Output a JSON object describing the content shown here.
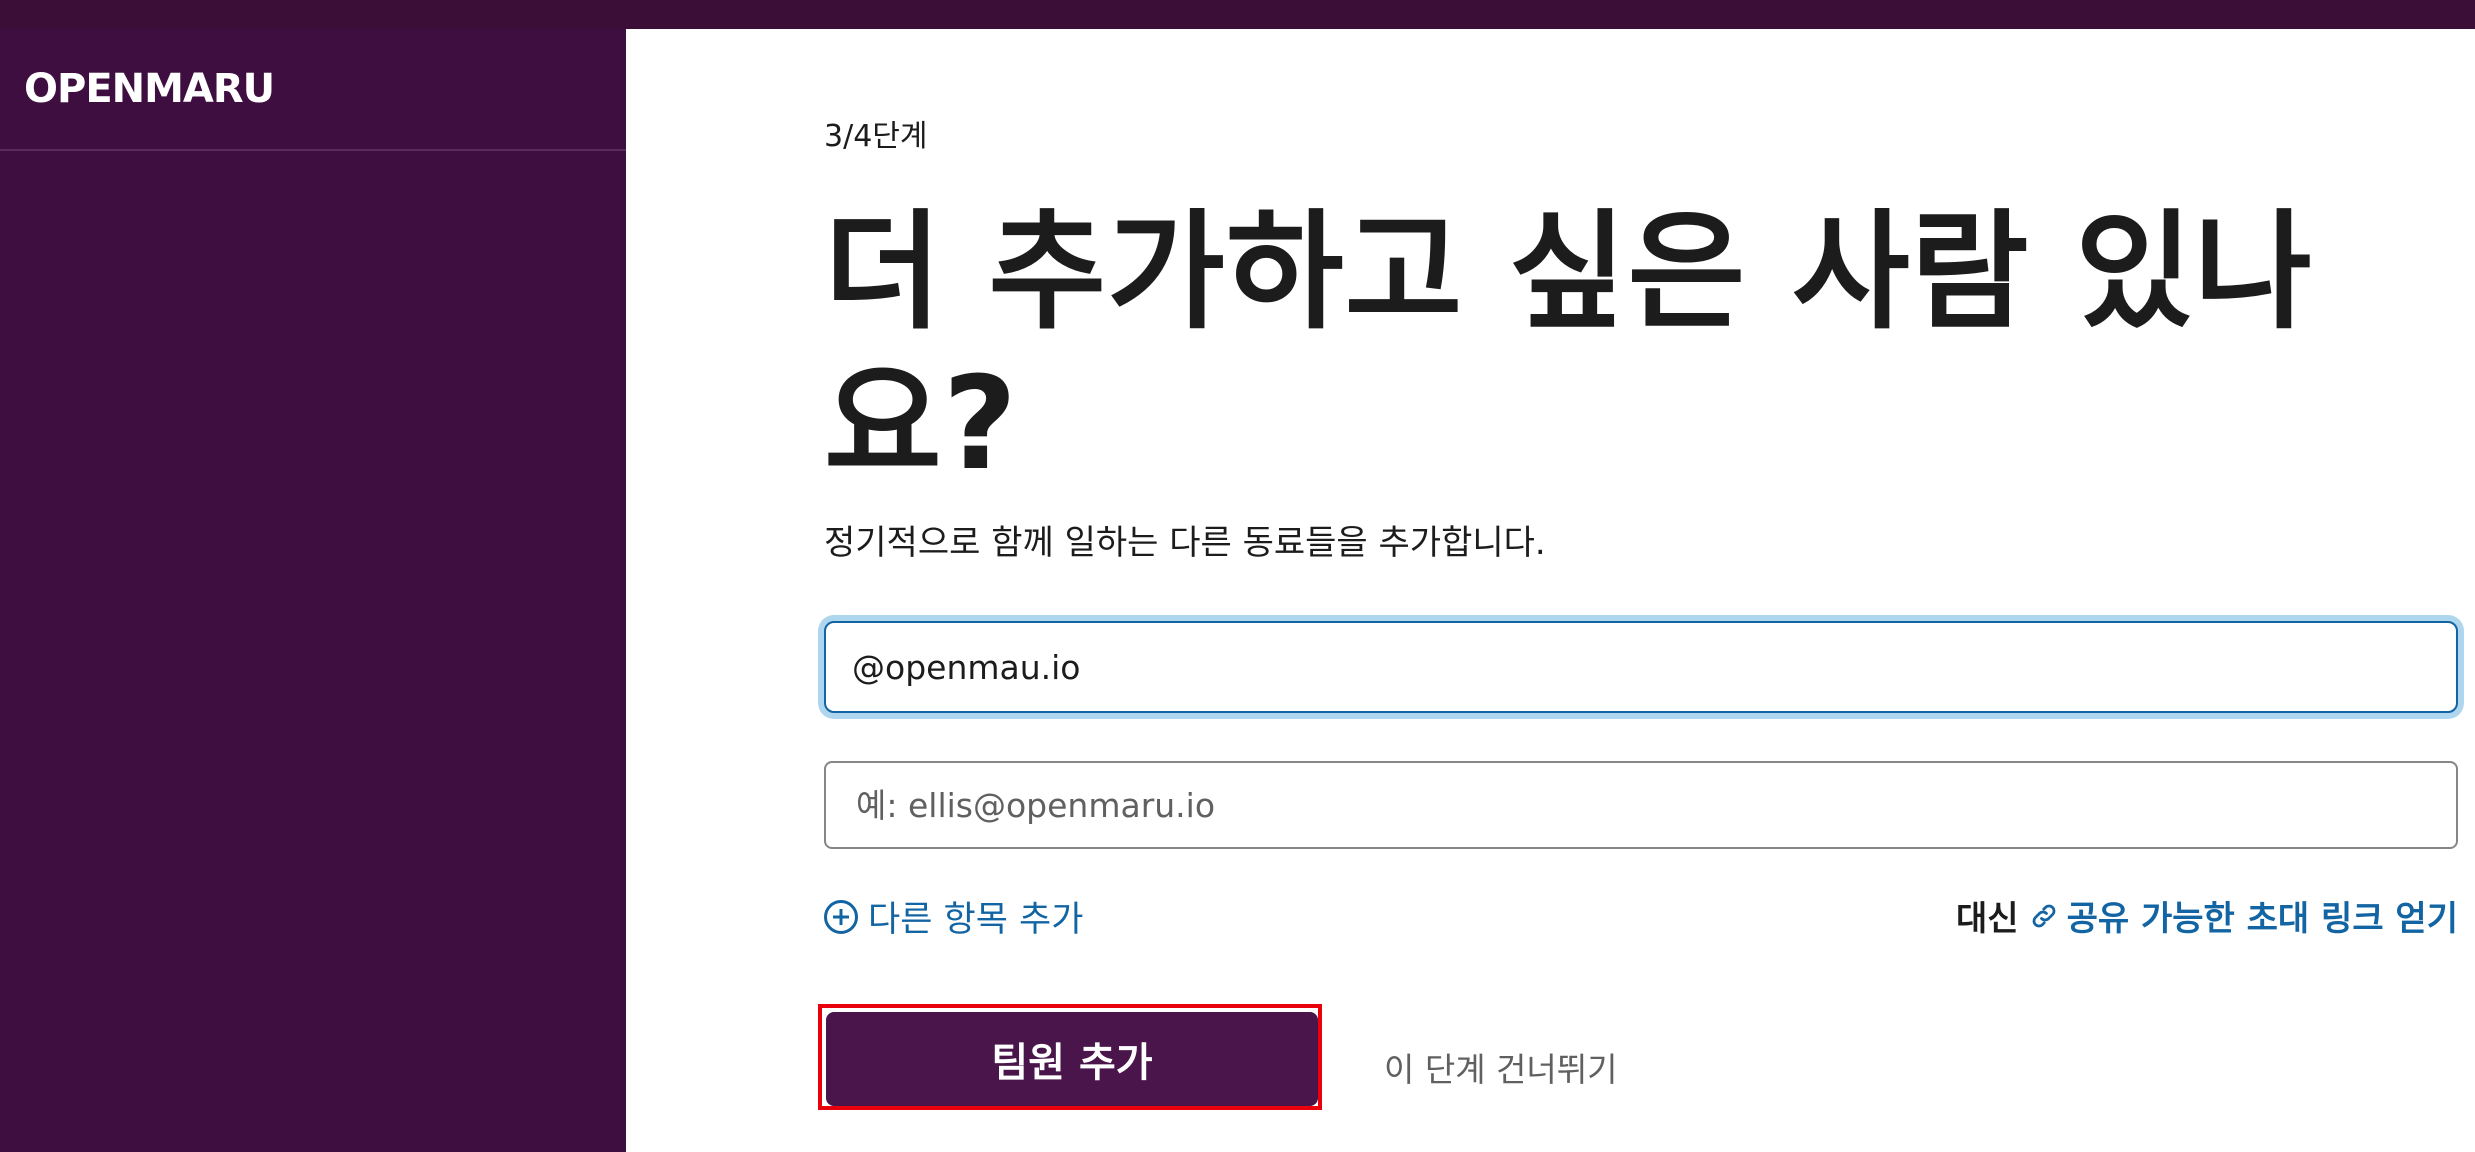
{
  "workspace": {
    "name": "OPENMARU"
  },
  "invite": {
    "step": "3/4단계",
    "title": "더 추가하고 싶은 사람 있나요?",
    "subtitle": "정기적으로 함께 일하는 다른 동료들을 추가합니다.",
    "email_inputs": [
      {
        "value": "@openmau.io",
        "placeholder": ""
      },
      {
        "value": "",
        "placeholder": "예: ellis@openmaru.io"
      }
    ],
    "add_item_label": "다른 항목 추가",
    "instead_label": "대신",
    "share_link_label": "공유 가능한 초대 링크 얻기",
    "add_member_button": "팀원 추가",
    "skip_label": "이 단계 건너뛰기"
  },
  "colors": {
    "sidebar_bg": "#3f0e40",
    "topbar_bg": "#3b0e37",
    "primary_button": "#4a154b",
    "link": "#1264a3",
    "highlight_outline": "#e8000b"
  },
  "icons": {
    "add_item": "plus-circle-icon",
    "share_link": "link-icon"
  }
}
